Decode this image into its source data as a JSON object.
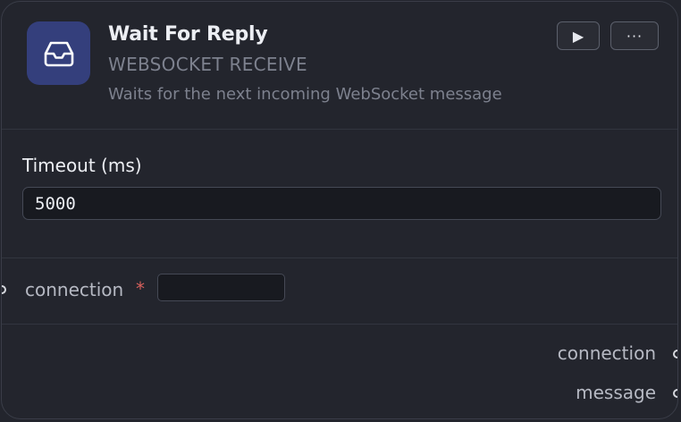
{
  "node": {
    "title": "Wait For Reply",
    "type_label": "WEBSOCKET RECEIVE",
    "description": "Waits for the next incoming WebSocket message",
    "icon": "inbox-icon",
    "accent_color": "#343f7c",
    "run_button_glyph": "▶",
    "more_button_glyph": "···"
  },
  "fields": {
    "timeout": {
      "label": "Timeout (ms)",
      "value": "5000"
    }
  },
  "inputs": [
    {
      "label": "connection",
      "required_marker": "*",
      "value": ""
    }
  ],
  "outputs": [
    {
      "label": "connection"
    },
    {
      "label": "message"
    }
  ]
}
